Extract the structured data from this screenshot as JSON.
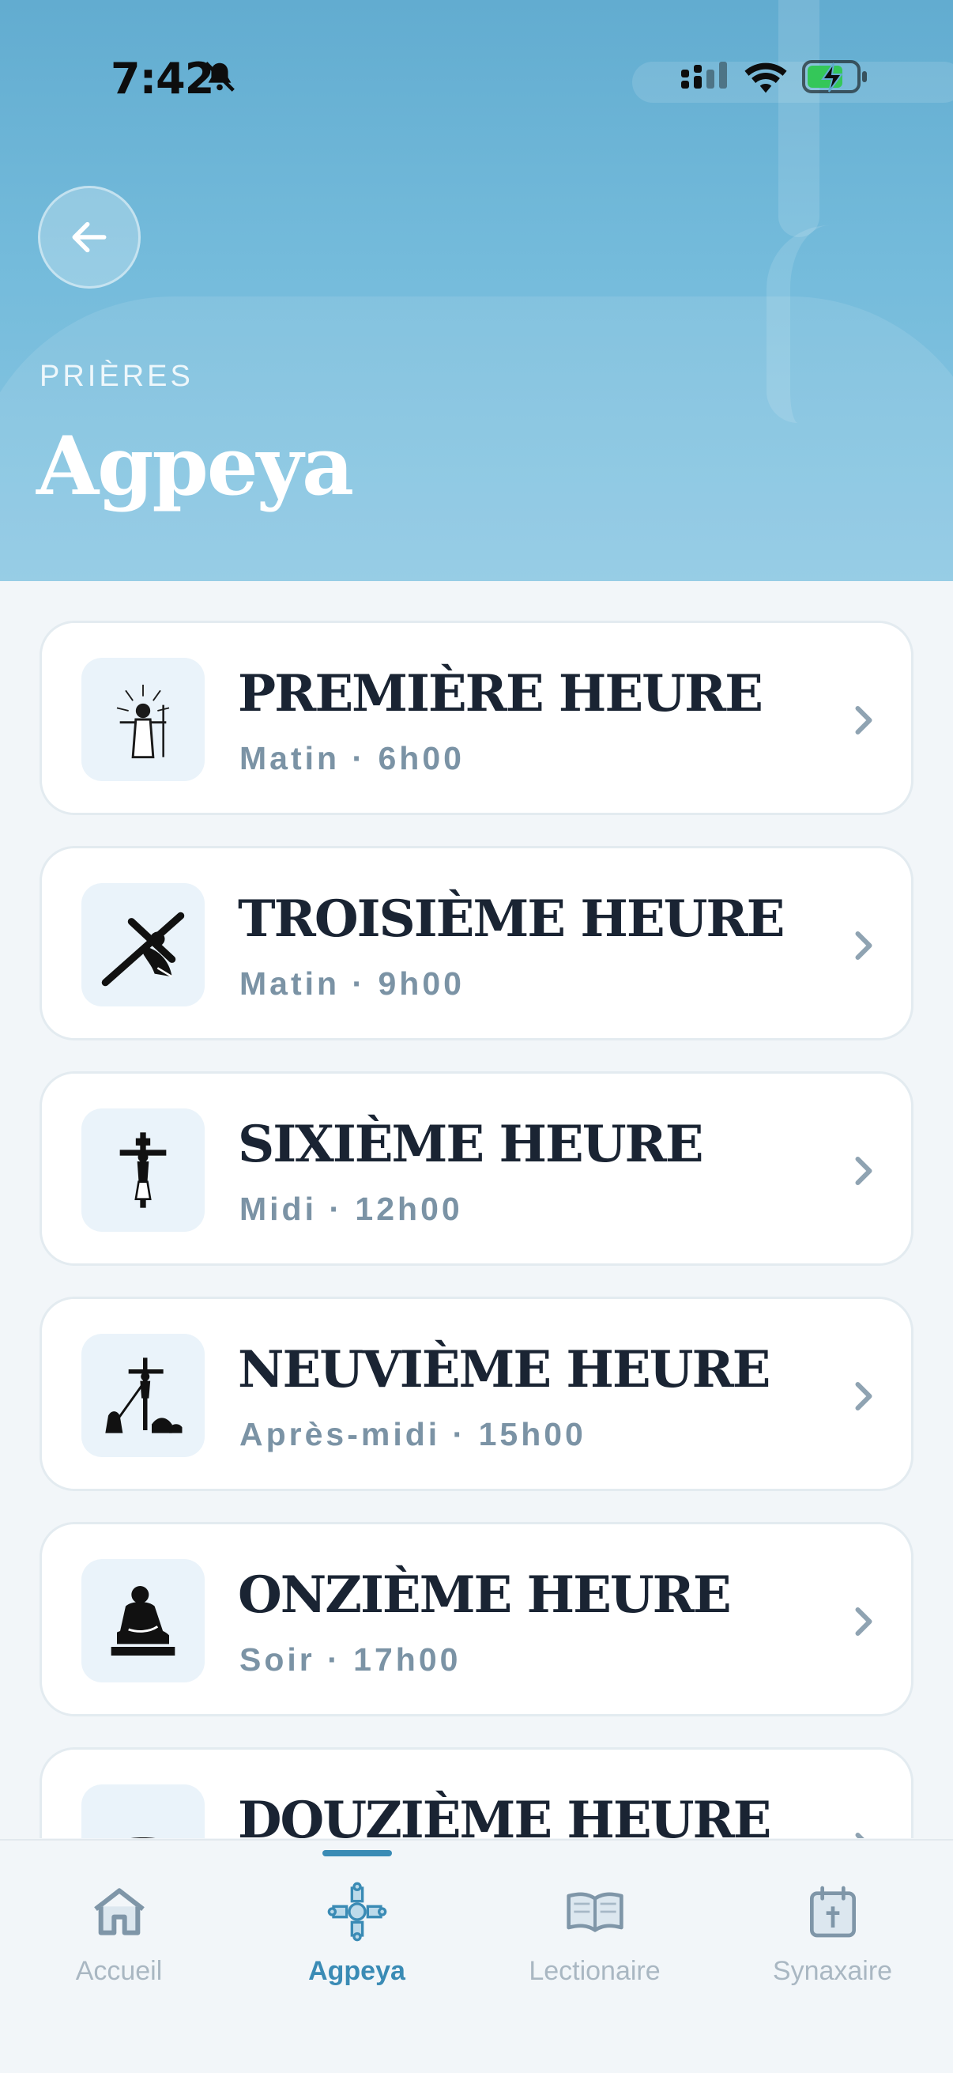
{
  "status_bar": {
    "time": "7:42"
  },
  "header": {
    "eyebrow": "PRIÈRES",
    "title": "Agpeya"
  },
  "hours": [
    {
      "name": "PREMIÈRE HEURE",
      "subtitle": "Matin · 6h00",
      "icon": "resurrection-icon"
    },
    {
      "name": "TROISIÈME HEURE",
      "subtitle": "Matin · 9h00",
      "icon": "cross-bearing-icon"
    },
    {
      "name": "SIXIÈME HEURE",
      "subtitle": "Midi · 12h00",
      "icon": "crucifix-icon"
    },
    {
      "name": "NEUVIÈME HEURE",
      "subtitle": "Après-midi · 15h00",
      "icon": "crucifixion-scene-icon"
    },
    {
      "name": "ONZIÈME HEURE",
      "subtitle": "Soir · 17h00",
      "icon": "pieta-icon"
    },
    {
      "name": "DOUZIÈME HEURE",
      "subtitle": "",
      "icon": "burial-icon"
    }
  ],
  "nav": [
    {
      "label": "Accueil",
      "icon": "home-icon"
    },
    {
      "label": "Agpeya",
      "icon": "coptic-cross-icon",
      "active": true
    },
    {
      "label": "Lectionaire",
      "icon": "open-book-icon"
    },
    {
      "label": "Synaxaire",
      "icon": "calendar-icon"
    }
  ],
  "colors": {
    "accent": "#3a8bb5",
    "header": "#6fb6d8",
    "card_icon_bg": "#eaf3fa"
  }
}
